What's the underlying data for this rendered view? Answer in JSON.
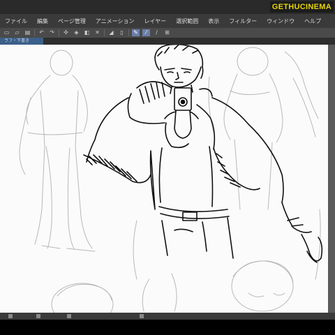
{
  "watermark": "GETHUCINEMA",
  "menu": {
    "items": [
      "ファイル",
      "編集",
      "ページ管理",
      "アニメーション",
      "レイヤー",
      "選択範囲",
      "表示",
      "フィルター",
      "ウィンドウ",
      "ヘルプ"
    ]
  },
  "toolbar": {
    "buttons": [
      {
        "name": "new-icon",
        "glyph": "▭"
      },
      {
        "name": "open-icon",
        "glyph": "▱"
      },
      {
        "name": "save-icon",
        "glyph": "▤"
      },
      {
        "name": "undo-icon",
        "glyph": "↶"
      },
      {
        "name": "redo-icon",
        "glyph": "↷"
      },
      {
        "name": "settings-icon",
        "glyph": "✣"
      },
      {
        "name": "transform-icon",
        "glyph": "◈"
      },
      {
        "name": "fill-icon",
        "glyph": "◧"
      },
      {
        "name": "clear-icon",
        "glyph": "✕"
      },
      {
        "name": "ruler-icon",
        "glyph": "◢"
      },
      {
        "name": "guide-icon",
        "glyph": "▯"
      },
      {
        "name": "pen-icon",
        "glyph": "✎",
        "active": true
      },
      {
        "name": "brush-icon",
        "glyph": "⁄",
        "active": true
      },
      {
        "name": "eraser-icon",
        "glyph": "/"
      },
      {
        "name": "layer-icon",
        "glyph": "⊞"
      }
    ]
  },
  "document": {
    "tab_label": "ラフ・下書き"
  },
  "colors": {
    "accent": "#3c5f8a",
    "paper": "#fbfbfb",
    "ink": "#111111",
    "sketch": "#b8b8b8"
  }
}
